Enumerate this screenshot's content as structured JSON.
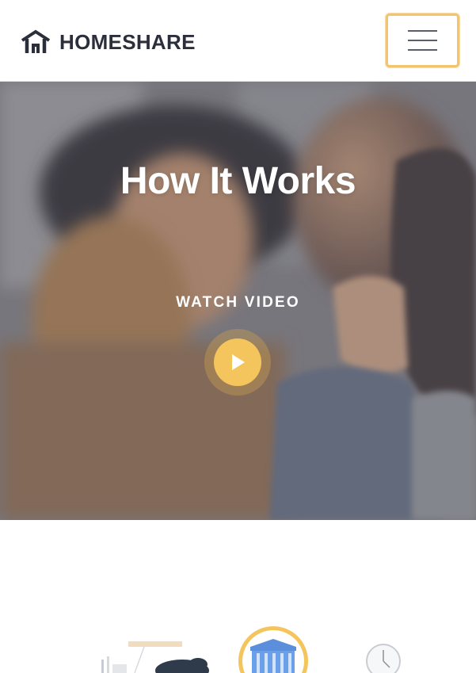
{
  "header": {
    "brand": "HOMESHARE",
    "logo_icon": "house-icon",
    "menu_icon": "hamburger-icon",
    "accent_color": "#f3c46d"
  },
  "hero": {
    "title": "How It Works",
    "subtitle": "WATCH VIDEO",
    "play_icon": "play-icon",
    "play_color": "#f4c45d"
  },
  "steps": {
    "icons": [
      "city-illustration",
      "bank-building-icon",
      "clock-icon"
    ]
  }
}
